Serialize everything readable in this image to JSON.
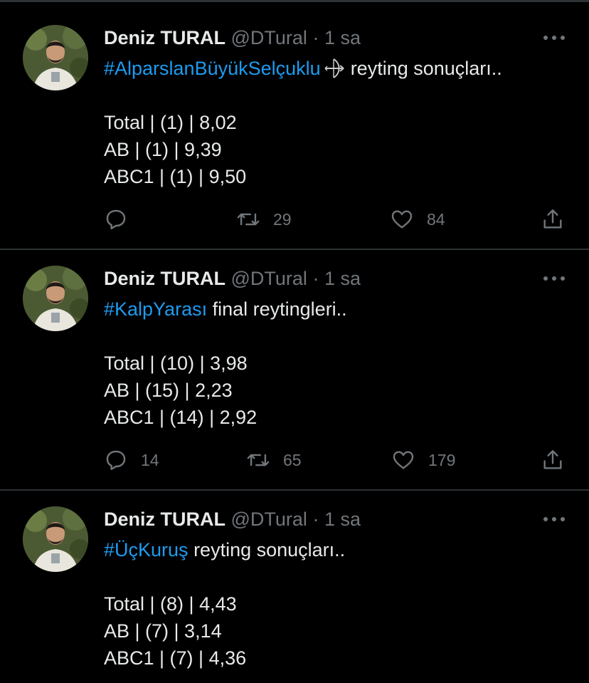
{
  "colors": {
    "background": "#000000",
    "text": "#e7e9ea",
    "muted": "#71767b",
    "link": "#1d9bf0",
    "divider": "#2f3336"
  },
  "tweets": [
    {
      "display_name": "Deniz TURAL",
      "handle": "@DTural",
      "separator": "·",
      "time": "1 sa",
      "hashtag": "#AlparslanBüyükSelçuklu",
      "emoji_icon": "bow-and-arrow-icon",
      "text_suffix": "reyting sonuçları..",
      "stats": [
        "Total | (1) | 8,02",
        "AB | (1) | 9,39",
        "ABC1 | (1) | 9,50"
      ],
      "reply_count": "",
      "retweet_count": "29",
      "like_count": "84"
    },
    {
      "display_name": "Deniz TURAL",
      "handle": "@DTural",
      "separator": "·",
      "time": "1 sa",
      "hashtag": "#KalpYarası",
      "text_suffix": "final reytingleri..",
      "stats": [
        "Total | (10) | 3,98",
        "AB | (15) | 2,23",
        "ABC1 | (14) | 2,92"
      ],
      "reply_count": "14",
      "retweet_count": "65",
      "like_count": "179"
    },
    {
      "display_name": "Deniz TURAL",
      "handle": "@DTural",
      "separator": "·",
      "time": "1 sa",
      "hashtag": "#ÜçKuruş",
      "text_suffix": "reyting sonuçları..",
      "stats": [
        "Total | (8) | 4,43",
        "AB | (7) | 3,14",
        "ABC1 | (7) | 4,36"
      ]
    }
  ]
}
